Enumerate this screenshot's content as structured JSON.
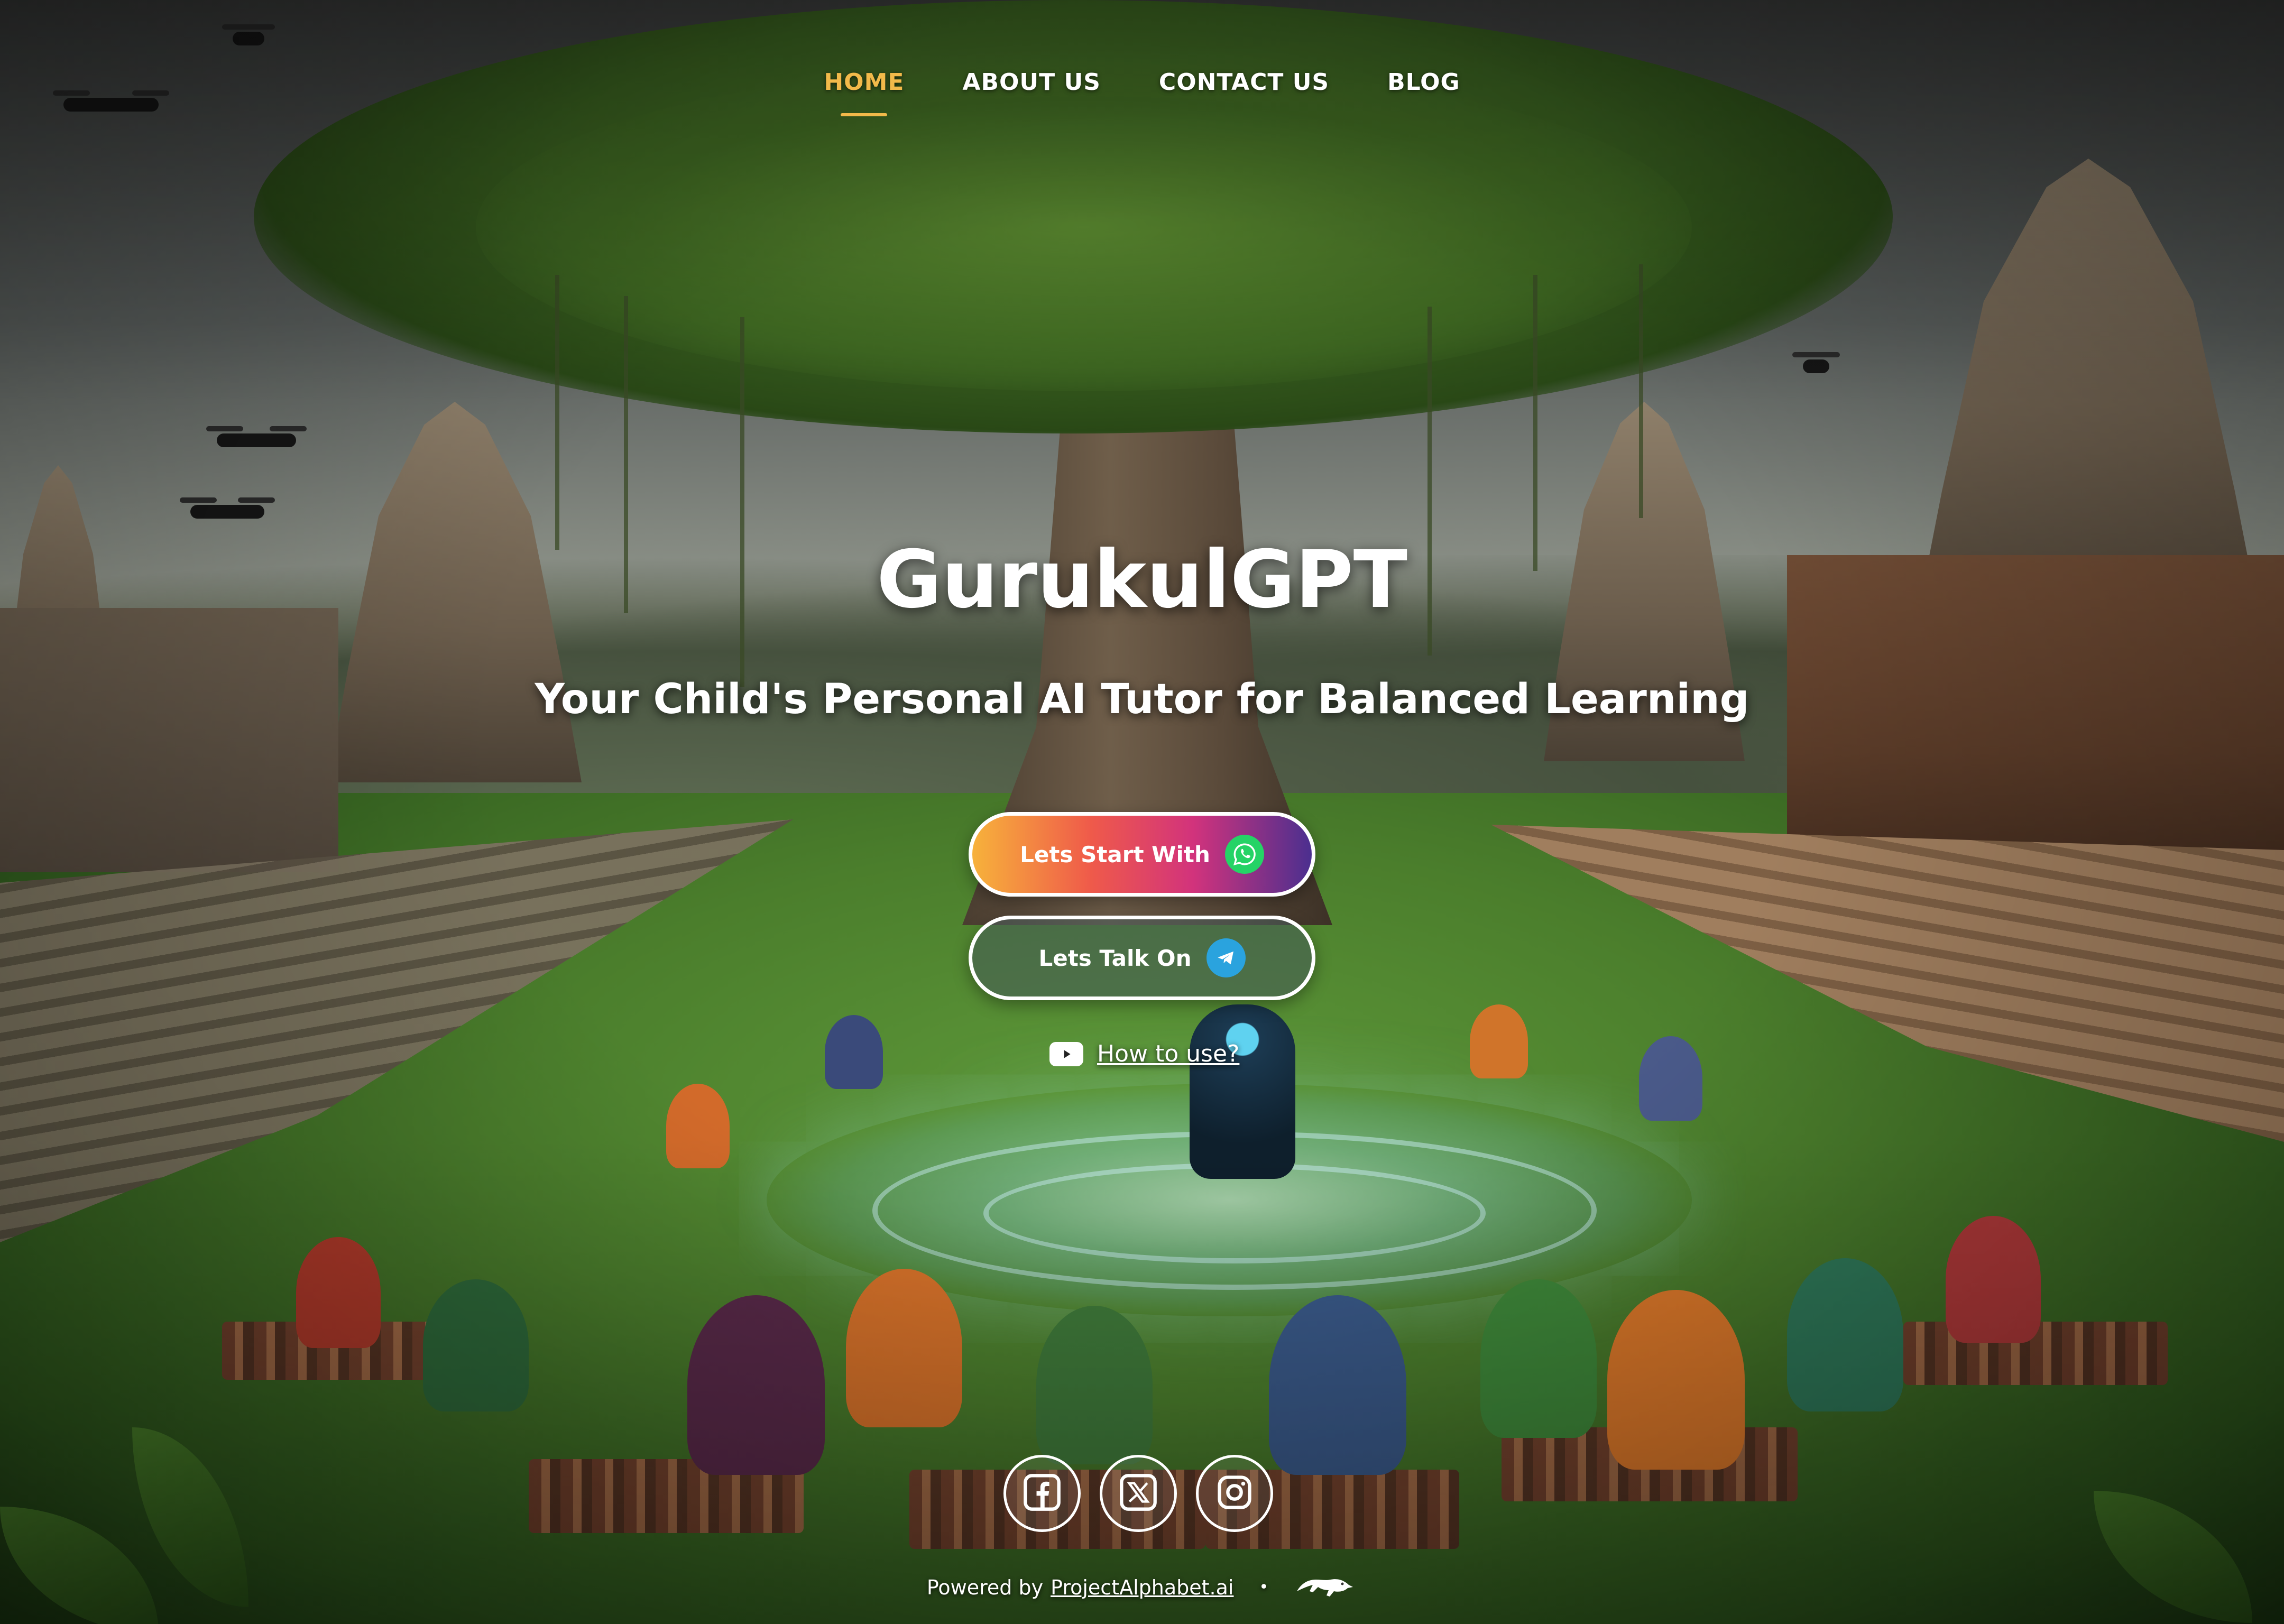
{
  "nav": {
    "items": [
      {
        "label": "HOME",
        "active": true
      },
      {
        "label": "ABOUT US",
        "active": false
      },
      {
        "label": "CONTACT US",
        "active": false
      },
      {
        "label": "BLOG",
        "active": false
      }
    ]
  },
  "hero": {
    "title": "GurukulGPT",
    "subtitle": "Your Child's Personal AI Tutor for Balanced Learning"
  },
  "cta": {
    "whatsapp_label": "Lets Start With",
    "whatsapp_icon": "whatsapp-icon",
    "telegram_label": "Lets Talk On",
    "telegram_icon": "telegram-icon"
  },
  "howto": {
    "label": "How to use?",
    "icon": "youtube-icon"
  },
  "social": [
    {
      "name": "facebook-icon"
    },
    {
      "name": "x-icon"
    },
    {
      "name": "instagram-icon"
    }
  ],
  "footer": {
    "powered_by": "Powered by",
    "link_label": "ProjectAlphabet.ai",
    "separator": "•",
    "logo": "make-in-india-lion-logo"
  },
  "colors": {
    "nav_active": "#f2b94a",
    "text": "#ffffff",
    "whatsapp_green": "#25d366",
    "telegram_blue": "#2aa3de"
  }
}
